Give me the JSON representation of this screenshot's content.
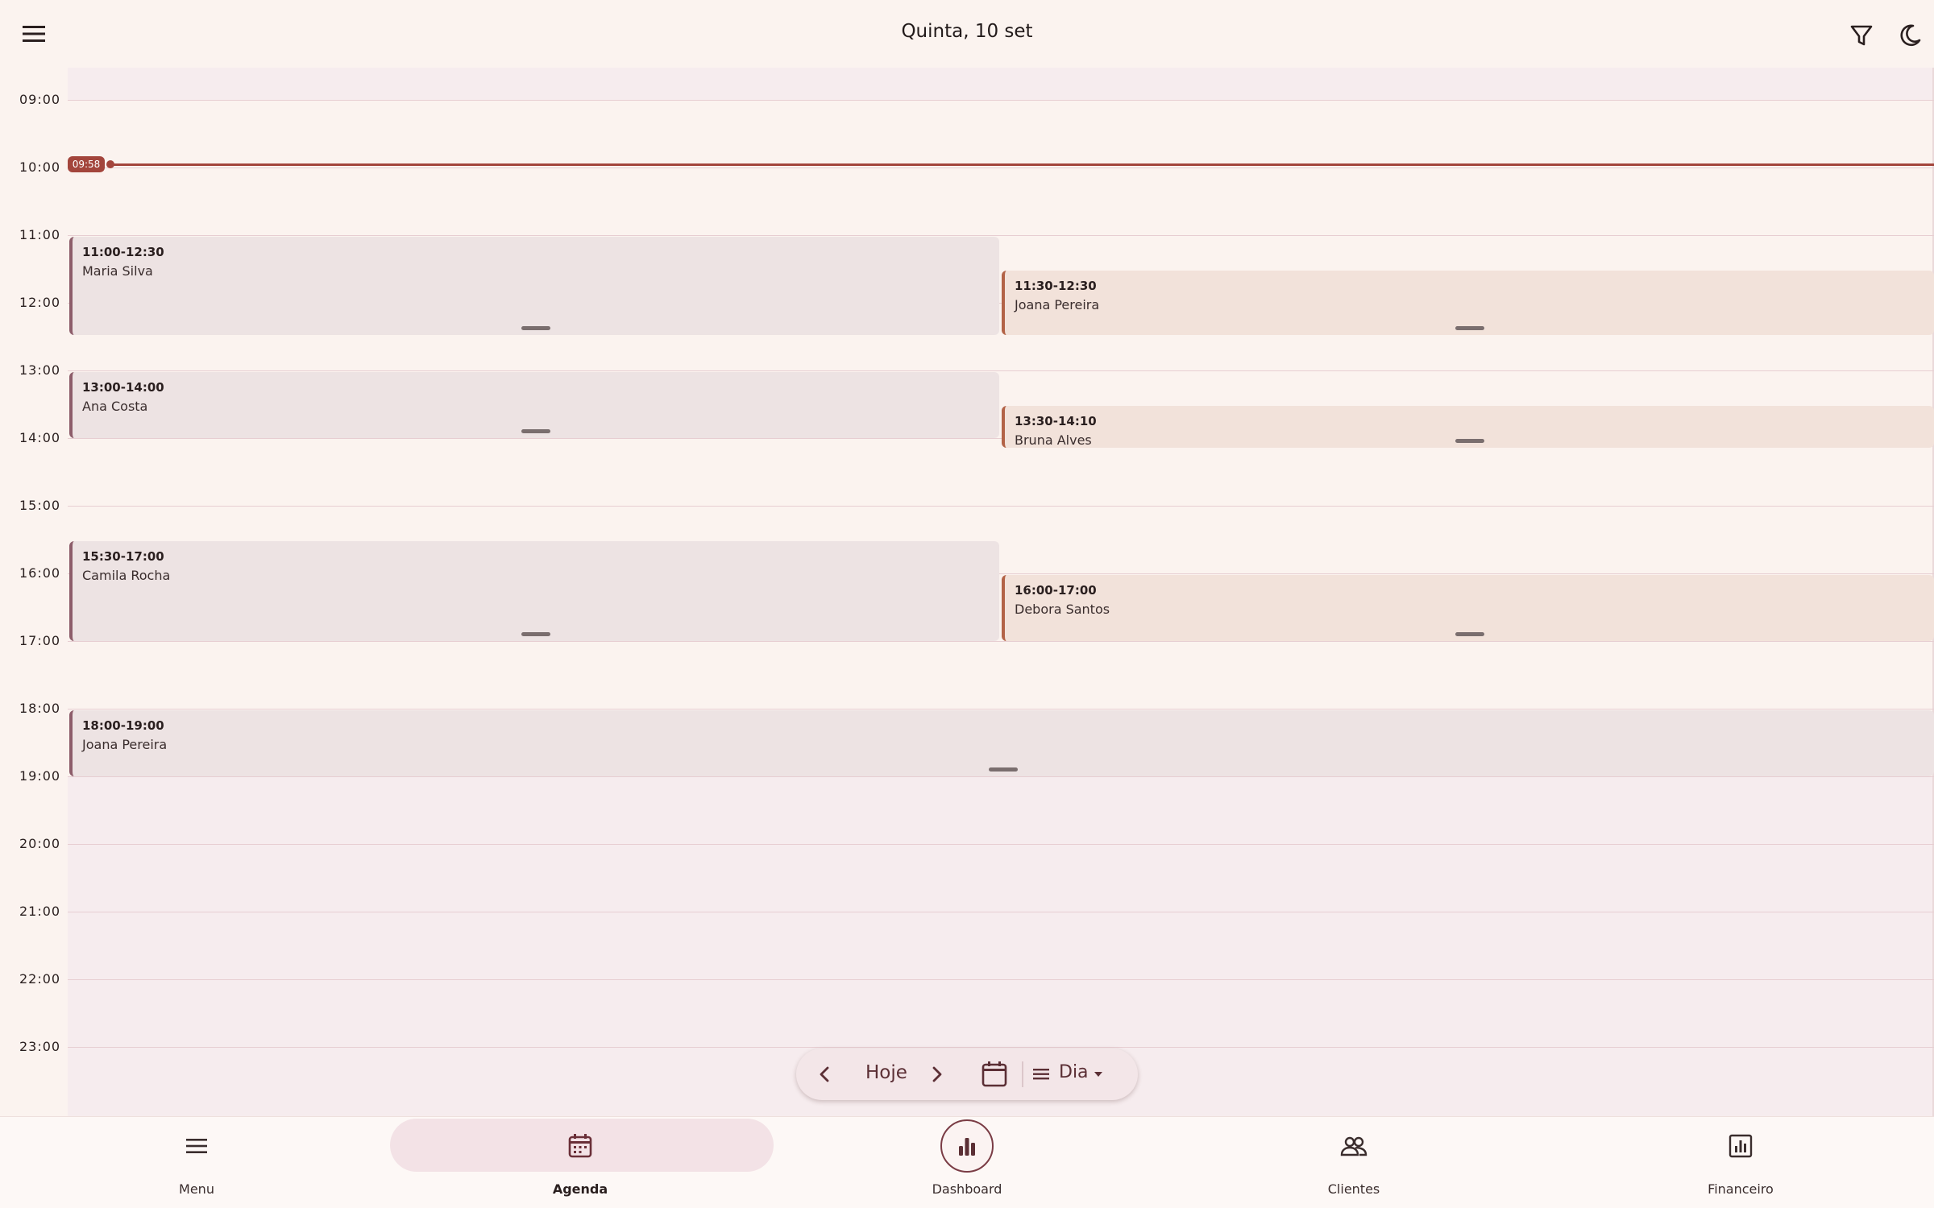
{
  "header": {
    "title": "Quinta, 10 set",
    "menu_icon": "menu-icon",
    "filter_icon": "filter-icon",
    "theme_icon": "moon-icon"
  },
  "calendar": {
    "hours": [
      "09:00",
      "10:00",
      "11:00",
      "12:00",
      "13:00",
      "14:00",
      "15:00",
      "16:00",
      "17:00",
      "18:00",
      "19:00",
      "20:00",
      "21:00",
      "22:00",
      "23:00"
    ],
    "now_time": "09:58",
    "events": [
      {
        "time": "11:00-12:30",
        "client": "Maria Silva"
      },
      {
        "time": "11:30-12:30",
        "client": "Joana Pereira"
      },
      {
        "time": "13:00-14:00",
        "client": "Ana Costa"
      },
      {
        "time": "13:30-14:10",
        "client": "Bruna Alves"
      },
      {
        "time": "15:30-17:00",
        "client": "Camila Rocha"
      },
      {
        "time": "16:00-17:00",
        "client": "Debora Santos"
      },
      {
        "time": "18:00-19:00",
        "client": "Joana Pereira"
      }
    ]
  },
  "toolbar": {
    "today_label": "Hoje",
    "view_label": "Dia",
    "prev_icon": "chevron-left-icon",
    "next_icon": "chevron-right-icon",
    "calendar_icon": "calendar-icon",
    "view_icon": "view-list-icon"
  },
  "bottom_nav": {
    "items": [
      {
        "label": "Menu",
        "icon": "menu-icon"
      },
      {
        "label": "Agenda",
        "icon": "calendar-icon",
        "active": true
      },
      {
        "label": "Dashboard",
        "icon": "bar-chart-icon"
      },
      {
        "label": "Clientes",
        "icon": "people-icon"
      },
      {
        "label": "Financeiro",
        "icon": "report-icon"
      }
    ]
  },
  "colors": {
    "accent": "#a3453c",
    "event_left_border": "#8d5d6a",
    "event_right_border": "#b36347"
  }
}
